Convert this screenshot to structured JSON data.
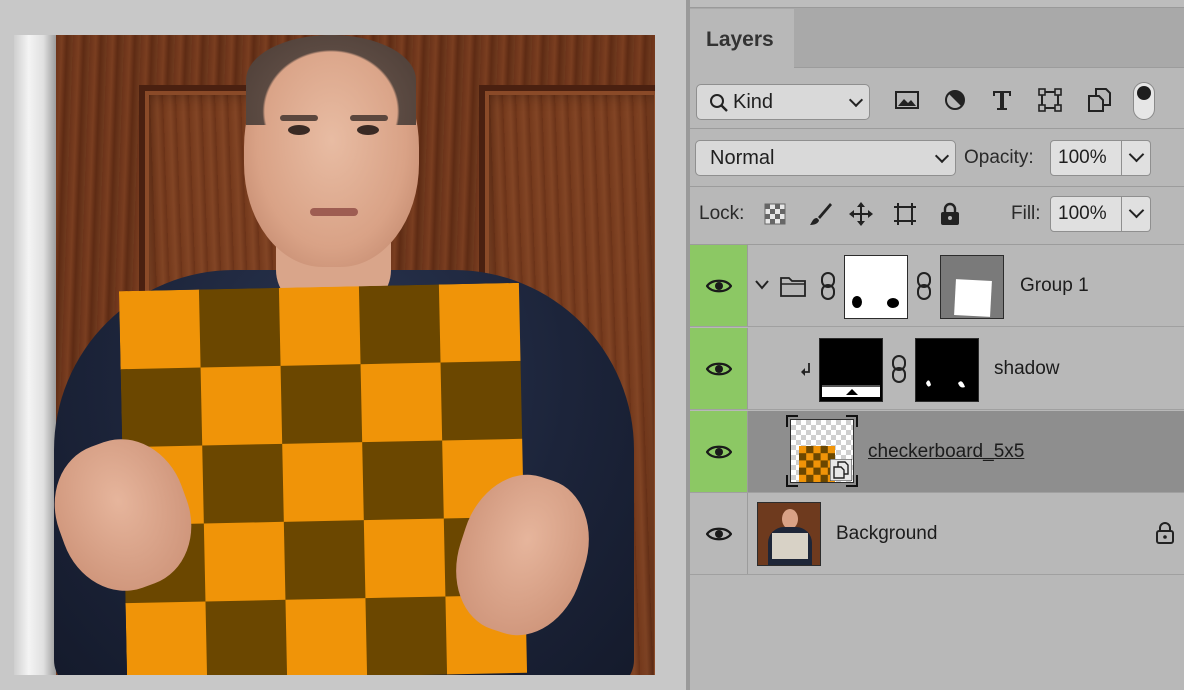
{
  "layers_panel": {
    "tab_label": "Layers",
    "filter": {
      "kind_label": "Kind",
      "icons": [
        "image-filter-icon",
        "adjustment-filter-icon",
        "type-filter-icon",
        "shape-filter-icon",
        "smart-object-filter-icon",
        "filter-toggle-icon"
      ]
    },
    "blend_mode": "Normal",
    "opacity_label": "Opacity:",
    "opacity_value": "100%",
    "lock_label": "Lock:",
    "fill_label": "Fill:",
    "fill_value": "100%",
    "layers": [
      {
        "name": "Group 1",
        "type": "group",
        "visible": true,
        "expanded": true
      },
      {
        "name": "shadow",
        "type": "clipped-adjustment",
        "visible": true
      },
      {
        "name": "checkerboard_5x5",
        "type": "smart-object",
        "visible": true,
        "selected": true
      },
      {
        "name": "Background",
        "type": "background",
        "visible": true,
        "locked": true
      }
    ]
  },
  "canvas": {
    "checkerboard": {
      "rows": 5,
      "cols": 5,
      "color_light": "#f09408",
      "color_dark": "#6b4700"
    }
  },
  "colors": {
    "visibility_green": "#8cc864",
    "selected_row": "#8e8e8e"
  }
}
